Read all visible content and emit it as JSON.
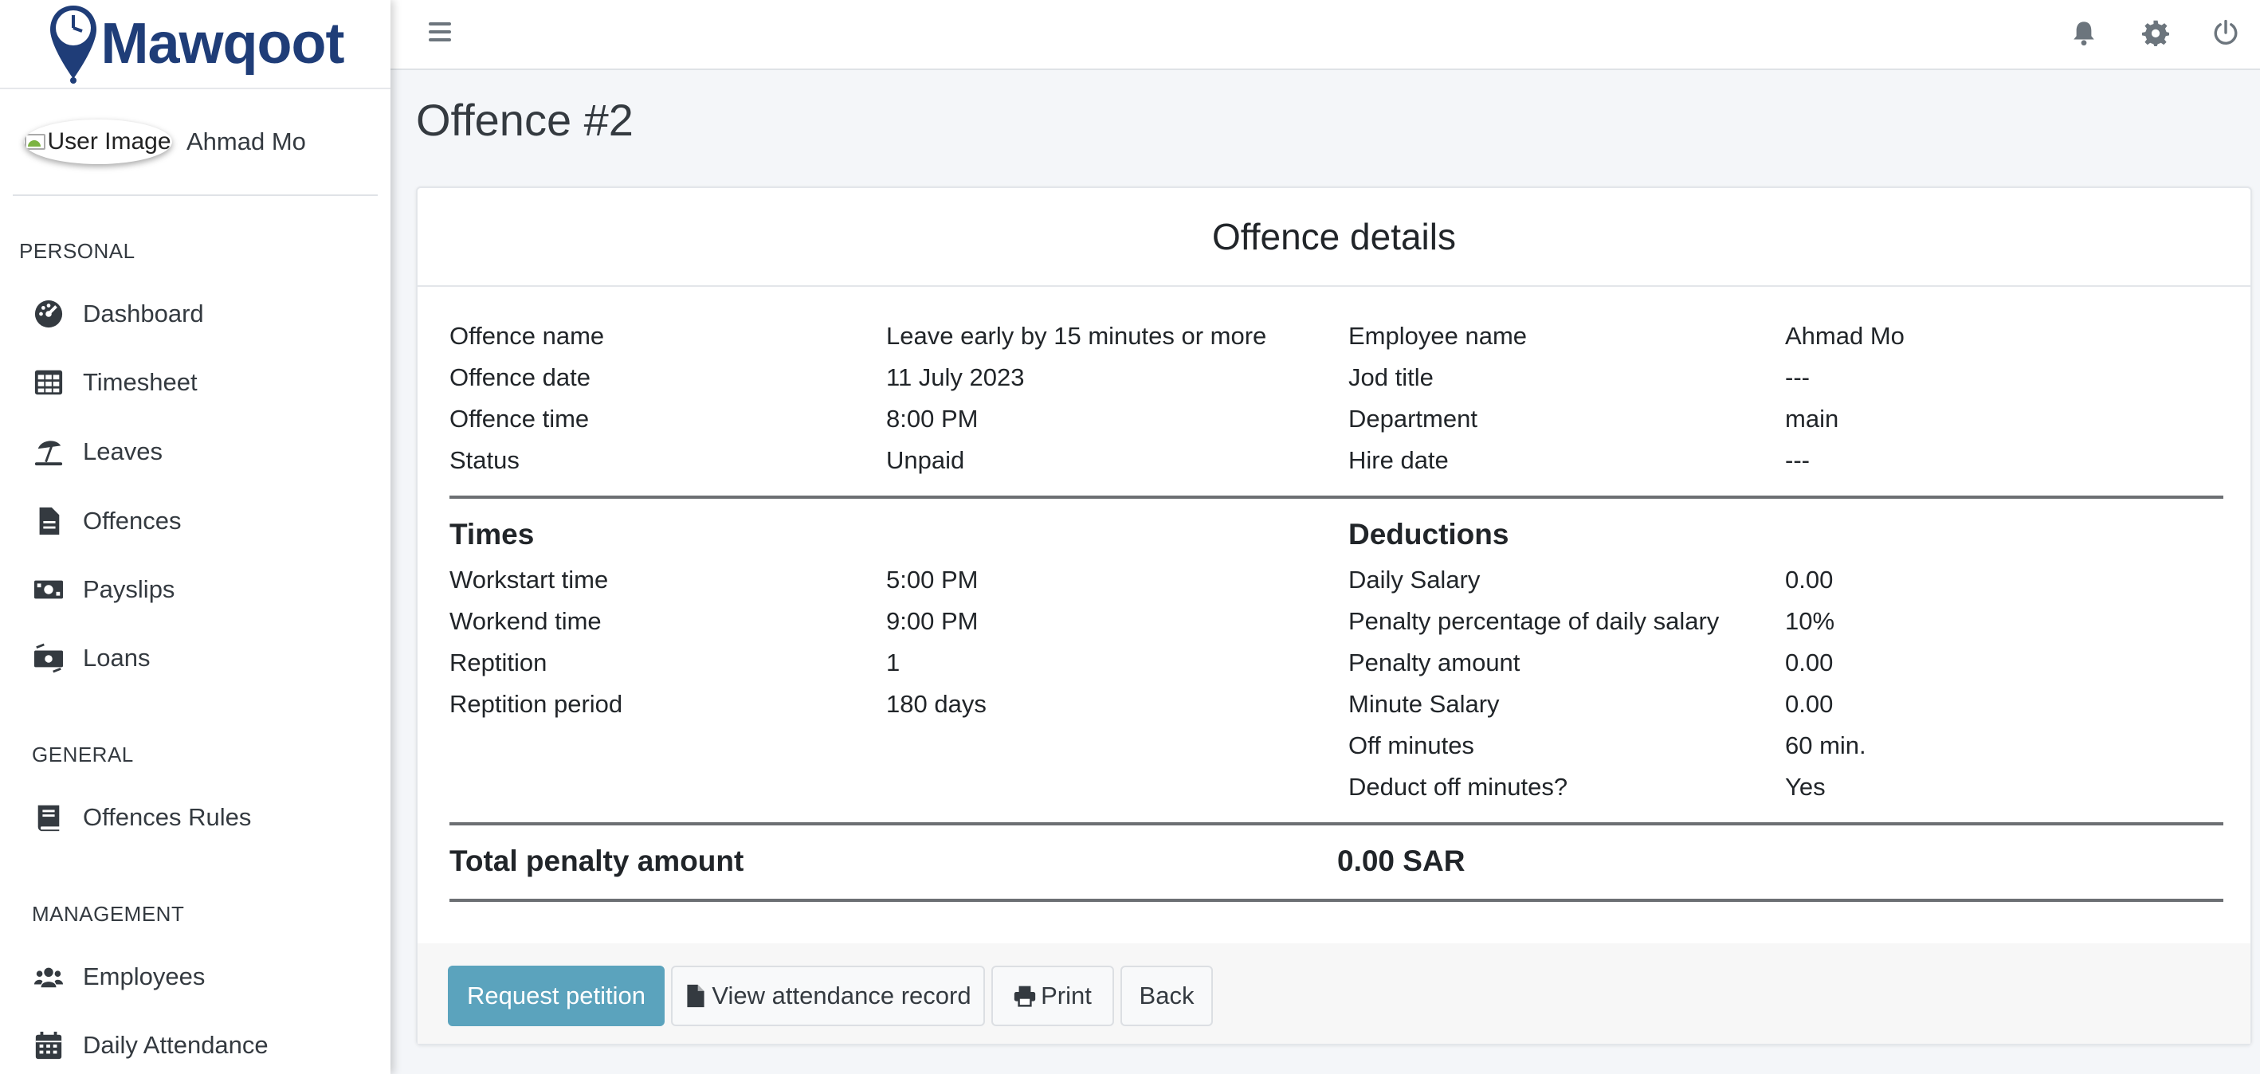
{
  "brand": {
    "name": "Mawqoot",
    "color": "#1f3d78"
  },
  "user": {
    "image_alt": "User Image",
    "name": "Ahmad Mo"
  },
  "sidebar": {
    "sections": [
      {
        "header": "PERSONAL",
        "items": [
          {
            "label": "Dashboard",
            "icon": "tachometer-icon"
          },
          {
            "label": "Timesheet",
            "icon": "table-icon"
          },
          {
            "label": "Leaves",
            "icon": "umbrella-beach-icon"
          },
          {
            "label": "Offences",
            "icon": "file-icon"
          },
          {
            "label": "Payslips",
            "icon": "money-bill-icon"
          },
          {
            "label": "Loans",
            "icon": "money-bill-wave-icon"
          }
        ]
      },
      {
        "header": "GENERAL",
        "items": [
          {
            "label": "Offences Rules",
            "icon": "book-icon"
          }
        ]
      },
      {
        "header": "MANAGEMENT",
        "items": [
          {
            "label": "Employees",
            "icon": "users-icon"
          },
          {
            "label": "Daily Attendance",
            "icon": "calendar-icon"
          }
        ]
      }
    ]
  },
  "topbar": {
    "icons": [
      "menu-icon",
      "bell-icon",
      "gear-icon",
      "power-icon"
    ]
  },
  "page": {
    "title": "Offence #2"
  },
  "card": {
    "title": "Offence details",
    "details_left": [
      {
        "label": "Offence name",
        "value": "Leave early by 15 minutes or more"
      },
      {
        "label": "Offence date",
        "value": "11 July 2023"
      },
      {
        "label": "Offence time",
        "value": "8:00 PM"
      },
      {
        "label": "Status",
        "value": "Unpaid"
      }
    ],
    "details_right": [
      {
        "label": "Employee name",
        "value": "Ahmad Mo"
      },
      {
        "label": "Jod title",
        "value": "---"
      },
      {
        "label": "Department",
        "value": "main"
      },
      {
        "label": "Hire date",
        "value": "---"
      }
    ],
    "times": {
      "title": "Times",
      "rows": [
        {
          "label": "Workstart time",
          "value": "5:00 PM"
        },
        {
          "label": "Workend time",
          "value": "9:00 PM"
        },
        {
          "label": "Reptition",
          "value": "1"
        },
        {
          "label": "Reptition period",
          "value": "180 days"
        }
      ]
    },
    "deductions": {
      "title": "Deductions",
      "rows": [
        {
          "label": "Daily Salary",
          "value": "0.00"
        },
        {
          "label": "Penalty percentage of daily salary",
          "value": "10%"
        },
        {
          "label": "Penalty amount",
          "value": "0.00"
        },
        {
          "label": "Minute Salary",
          "value": "0.00"
        },
        {
          "label": "Off minutes",
          "value": "60 min."
        },
        {
          "label": "Deduct off minutes?",
          "value": "Yes"
        }
      ]
    },
    "total": {
      "label": "Total penalty amount",
      "value": "0.00 SAR"
    }
  },
  "buttons": {
    "request_petition": "Request petition",
    "view_attendance": "View attendance record",
    "print": "Print",
    "back": "Back"
  },
  "colors": {
    "primary_button": "#5ba3bd",
    "page_bg": "#f4f6f9"
  }
}
